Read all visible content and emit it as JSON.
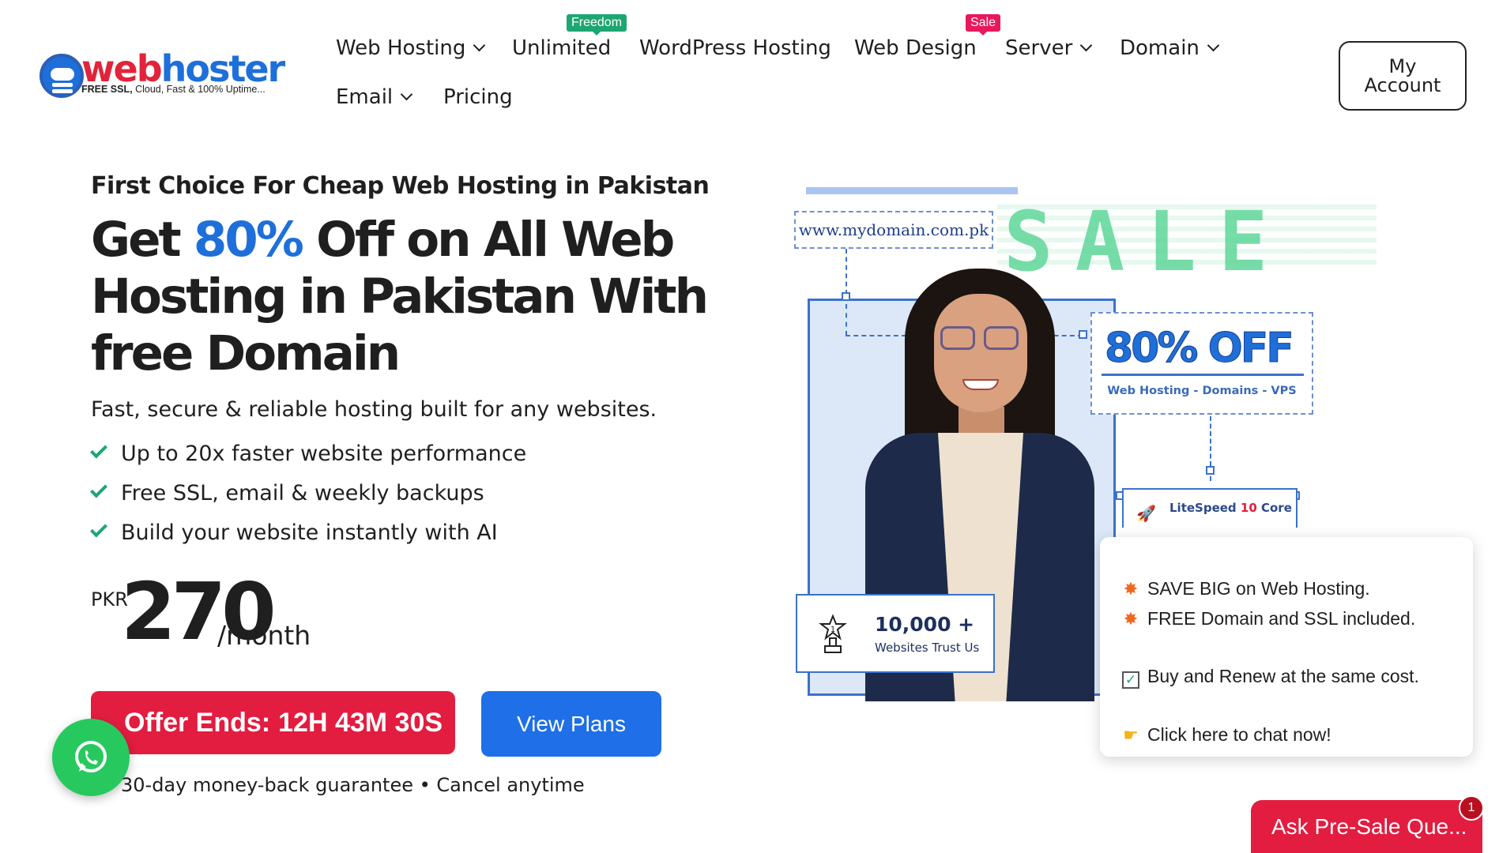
{
  "logo": {
    "word_part1": "web",
    "word_part2": "hoster",
    "tagline_bold": "FREE SSL,",
    "tagline_rest": " Cloud, Fast & 100% Uptime..."
  },
  "nav": {
    "items": [
      {
        "label": "Web Hosting",
        "dropdown": true
      },
      {
        "label": "Unlimited",
        "dropdown": false,
        "badge": "Freedom"
      },
      {
        "label": "WordPress Hosting",
        "dropdown": false
      },
      {
        "label": "Web Design",
        "dropdown": false,
        "badge": "Sale"
      },
      {
        "label": "Server",
        "dropdown": true
      },
      {
        "label": "Domain",
        "dropdown": true
      },
      {
        "label": "Email",
        "dropdown": true
      },
      {
        "label": "Pricing",
        "dropdown": false
      }
    ],
    "account_label_line1": "My",
    "account_label_line2": "Account"
  },
  "hero": {
    "eyebrow": "First Choice For Cheap Web Hosting in Pakistan",
    "headline_part1": "Get ",
    "headline_highlight": "80%",
    "headline_part2": " Off on All Web Hosting in Pakistan With free Domain",
    "subline": "Fast, secure & reliable hosting built for any websites.",
    "features": [
      "Up to 20x faster website performance",
      "Free SSL, email & weekly backups",
      "Build your website instantly with AI"
    ],
    "price": {
      "currency": "PKR",
      "value": "270",
      "period": "/month"
    },
    "offer_label": "Offer Ends:",
    "offer_timer": "12H 43M 30S",
    "view_plans_label": "View Plans",
    "guarantee": "30-day money-back guarantee • Cancel anytime"
  },
  "illustration": {
    "domain_text": "www.mydomain.com.pk",
    "sale_text": "SALE",
    "off_title": "80% OFF",
    "off_sub": "Web Hosting  -  Domains  -  VPS",
    "litespeed_prefix": "LiteSpeed ",
    "litespeed_cores": "10",
    "litespeed_suffix": " Core",
    "trust_count": "10,000 +",
    "trust_label": "Websites Trust Us"
  },
  "chat": {
    "lines": [
      "SAVE BIG on Web Hosting.",
      "FREE Domain and SSL included.",
      "Buy and Renew at the same cost.",
      "Click here to chat now!"
    ],
    "presale_label": "Ask Pre-Sale Que...",
    "unread_count": "1"
  },
  "colors": {
    "brand_blue": "#1e6fd9",
    "brand_red": "#e21d40",
    "check_green": "#1ea672",
    "whatsapp_green": "#27c95f"
  },
  "icons": {
    "check": "check-icon",
    "whatsapp": "whatsapp-icon",
    "chevron": "chevron-down-icon",
    "trophy": "trophy-icon",
    "rocket": "rocket-icon"
  }
}
